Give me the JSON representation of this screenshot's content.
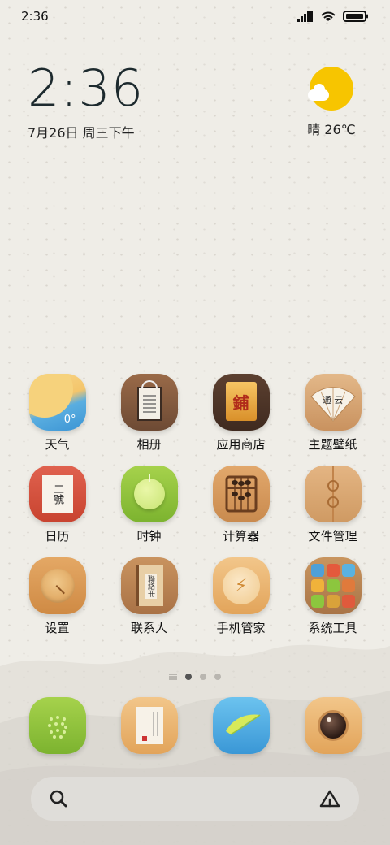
{
  "status_bar": {
    "time": "2:36"
  },
  "clock": {
    "time": "2:36",
    "date": "7月26日 周三下午"
  },
  "weather": {
    "text": "晴 26℃"
  },
  "apps": [
    {
      "label": "天气",
      "icon": "weather-icon",
      "badge": "0°"
    },
    {
      "label": "相册",
      "icon": "gallery-icon"
    },
    {
      "label": "应用商店",
      "icon": "app-store-icon",
      "glyph": "鋪"
    },
    {
      "label": "主题壁纸",
      "icon": "themes-icon",
      "glyph": "通 云"
    },
    {
      "label": "日历",
      "icon": "calendar-icon",
      "glyph": "二號"
    },
    {
      "label": "时钟",
      "icon": "clock-icon"
    },
    {
      "label": "计算器",
      "icon": "abacus-icon"
    },
    {
      "label": "文件管理",
      "icon": "file-manager-icon"
    },
    {
      "label": "设置",
      "icon": "settings-icon"
    },
    {
      "label": "联系人",
      "icon": "contacts-icon",
      "glyph": "聯絡冊"
    },
    {
      "label": "手机管家",
      "icon": "security-icon",
      "glyph": "⚡"
    },
    {
      "label": "系统工具",
      "icon": "tools-folder-icon"
    }
  ],
  "dock": [
    {
      "icon": "phone-dialer-icon"
    },
    {
      "icon": "messages-icon"
    },
    {
      "icon": "browser-icon"
    },
    {
      "icon": "camera-icon"
    }
  ],
  "search": {
    "icon": "search-icon",
    "assistant_icon": "assistant-icon"
  },
  "page_indicator": {
    "pages": 3,
    "active": 1
  },
  "colors": {
    "background": "#efede7",
    "sun": "#f7c500",
    "accent_green": "#8cc63e"
  }
}
